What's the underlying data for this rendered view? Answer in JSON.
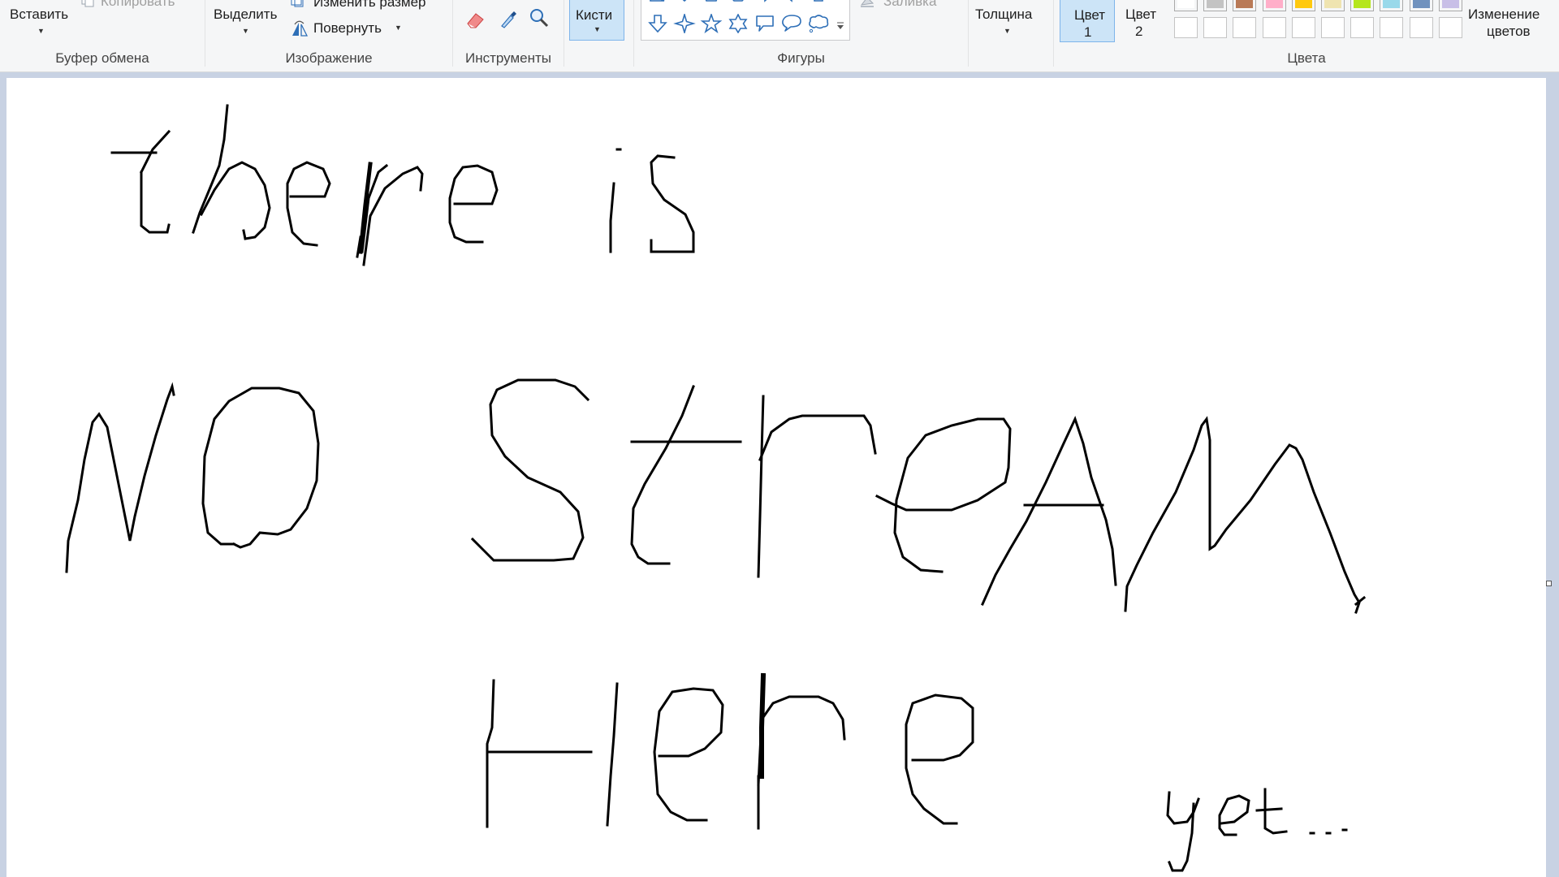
{
  "clipboard": {
    "paste_label": "Вставить",
    "copy_label": "Копировать",
    "group_label": "Буфер обмена"
  },
  "image": {
    "select_label": "Выделить",
    "resize_label": "Изменить размер",
    "rotate_label": "Повернуть",
    "group_label": "Изображение"
  },
  "tools": {
    "icons": [
      "eraser-icon",
      "color-picker-icon",
      "magnifier-icon"
    ],
    "group_label": "Инструменты"
  },
  "brushes": {
    "label": "Кисти"
  },
  "shapes": {
    "row1": [
      "triangle-icon",
      "diamond-icon",
      "pentagon-icon",
      "hexagon-icon",
      "right-arrow-icon",
      "left-arrow-icon",
      "up-arrow-icon"
    ],
    "row2": [
      "down-arrow-icon",
      "four-point-star-icon",
      "five-point-star-icon",
      "six-point-star-icon",
      "rect-callout-icon",
      "oval-callout-icon",
      "cloud-callout-icon"
    ],
    "fill_label": "Заливка",
    "group_label": "Фигуры"
  },
  "size": {
    "label": "Толщина"
  },
  "colors": {
    "color1_label_line1": "Цвет",
    "color1_label_line2": "1",
    "color2_label_line1": "Цвет",
    "color2_label_line2": "2",
    "edit_label_line1": "Изменение",
    "edit_label_line2": "цветов",
    "group_label": "Цвета",
    "palette_row1": [
      "#ffffff",
      "#c3c3c3",
      "#b97a57",
      "#ffaec9",
      "#ffc90e",
      "#efe4b0",
      "#b5e61d",
      "#99d9ea",
      "#7092be",
      "#c8bfe7"
    ]
  },
  "canvas": {
    "background": "#ffffff",
    "ink_color": "#000000",
    "handwriting_lines": [
      "there is",
      "NO StreAM",
      "Here",
      "yet..."
    ]
  }
}
